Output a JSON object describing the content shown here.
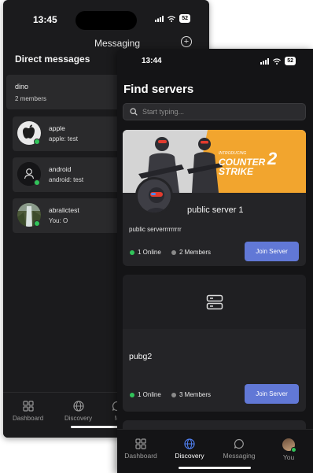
{
  "back": {
    "time": "13:45",
    "battery": "52",
    "title": "Messaging",
    "section_title": "Direct messages",
    "group": {
      "name": "dino",
      "members": "2 members"
    },
    "dms": [
      {
        "name": "apple",
        "last_sender": "apple:",
        "last_text": "test",
        "online": true,
        "avatar_icon": "apple-logo-avatar"
      },
      {
        "name": "android",
        "last_sender": "android:",
        "last_text": "test",
        "online": true,
        "avatar_icon": "person-icon"
      },
      {
        "name": "abralictest",
        "last_sender": "You:",
        "last_text": "O",
        "online": true,
        "avatar_icon": "waterfall-photo-avatar"
      }
    ],
    "tabs": [
      {
        "label": "Dashboard",
        "icon": "grid-icon"
      },
      {
        "label": "Discovery",
        "icon": "globe-icon"
      },
      {
        "label": "M",
        "icon": "chat-icon"
      }
    ]
  },
  "front": {
    "time": "13:44",
    "battery": "52",
    "title": "Find servers",
    "search": {
      "placeholder": "Start typing..."
    },
    "banner_text": {
      "line1": "COUNTER",
      "line2": "STRIKE",
      "num": "2",
      "small": "INTRODUCING"
    },
    "servers": [
      {
        "name": "public server 1",
        "description": "public serverrrrrrrrr",
        "online": "1 Online",
        "members": "2 Members",
        "join": "Join Server"
      },
      {
        "name": "pubg2",
        "description": "",
        "online": "1 Online",
        "members": "3 Members",
        "join": "Join Server"
      }
    ],
    "tabs": [
      {
        "label": "Dashboard",
        "icon": "grid-icon",
        "active": false
      },
      {
        "label": "Discovery",
        "icon": "globe-icon",
        "active": true
      },
      {
        "label": "Messaging",
        "icon": "chat-icon",
        "active": false
      },
      {
        "label": "You",
        "icon": "user-avatar",
        "active": false
      }
    ]
  },
  "colors": {
    "accent": "#6178d6",
    "online": "#31c45a",
    "member": "#8a8a8a",
    "active_tab_icon": "#4f7ff0",
    "banner_orange": "#f2a52e"
  }
}
